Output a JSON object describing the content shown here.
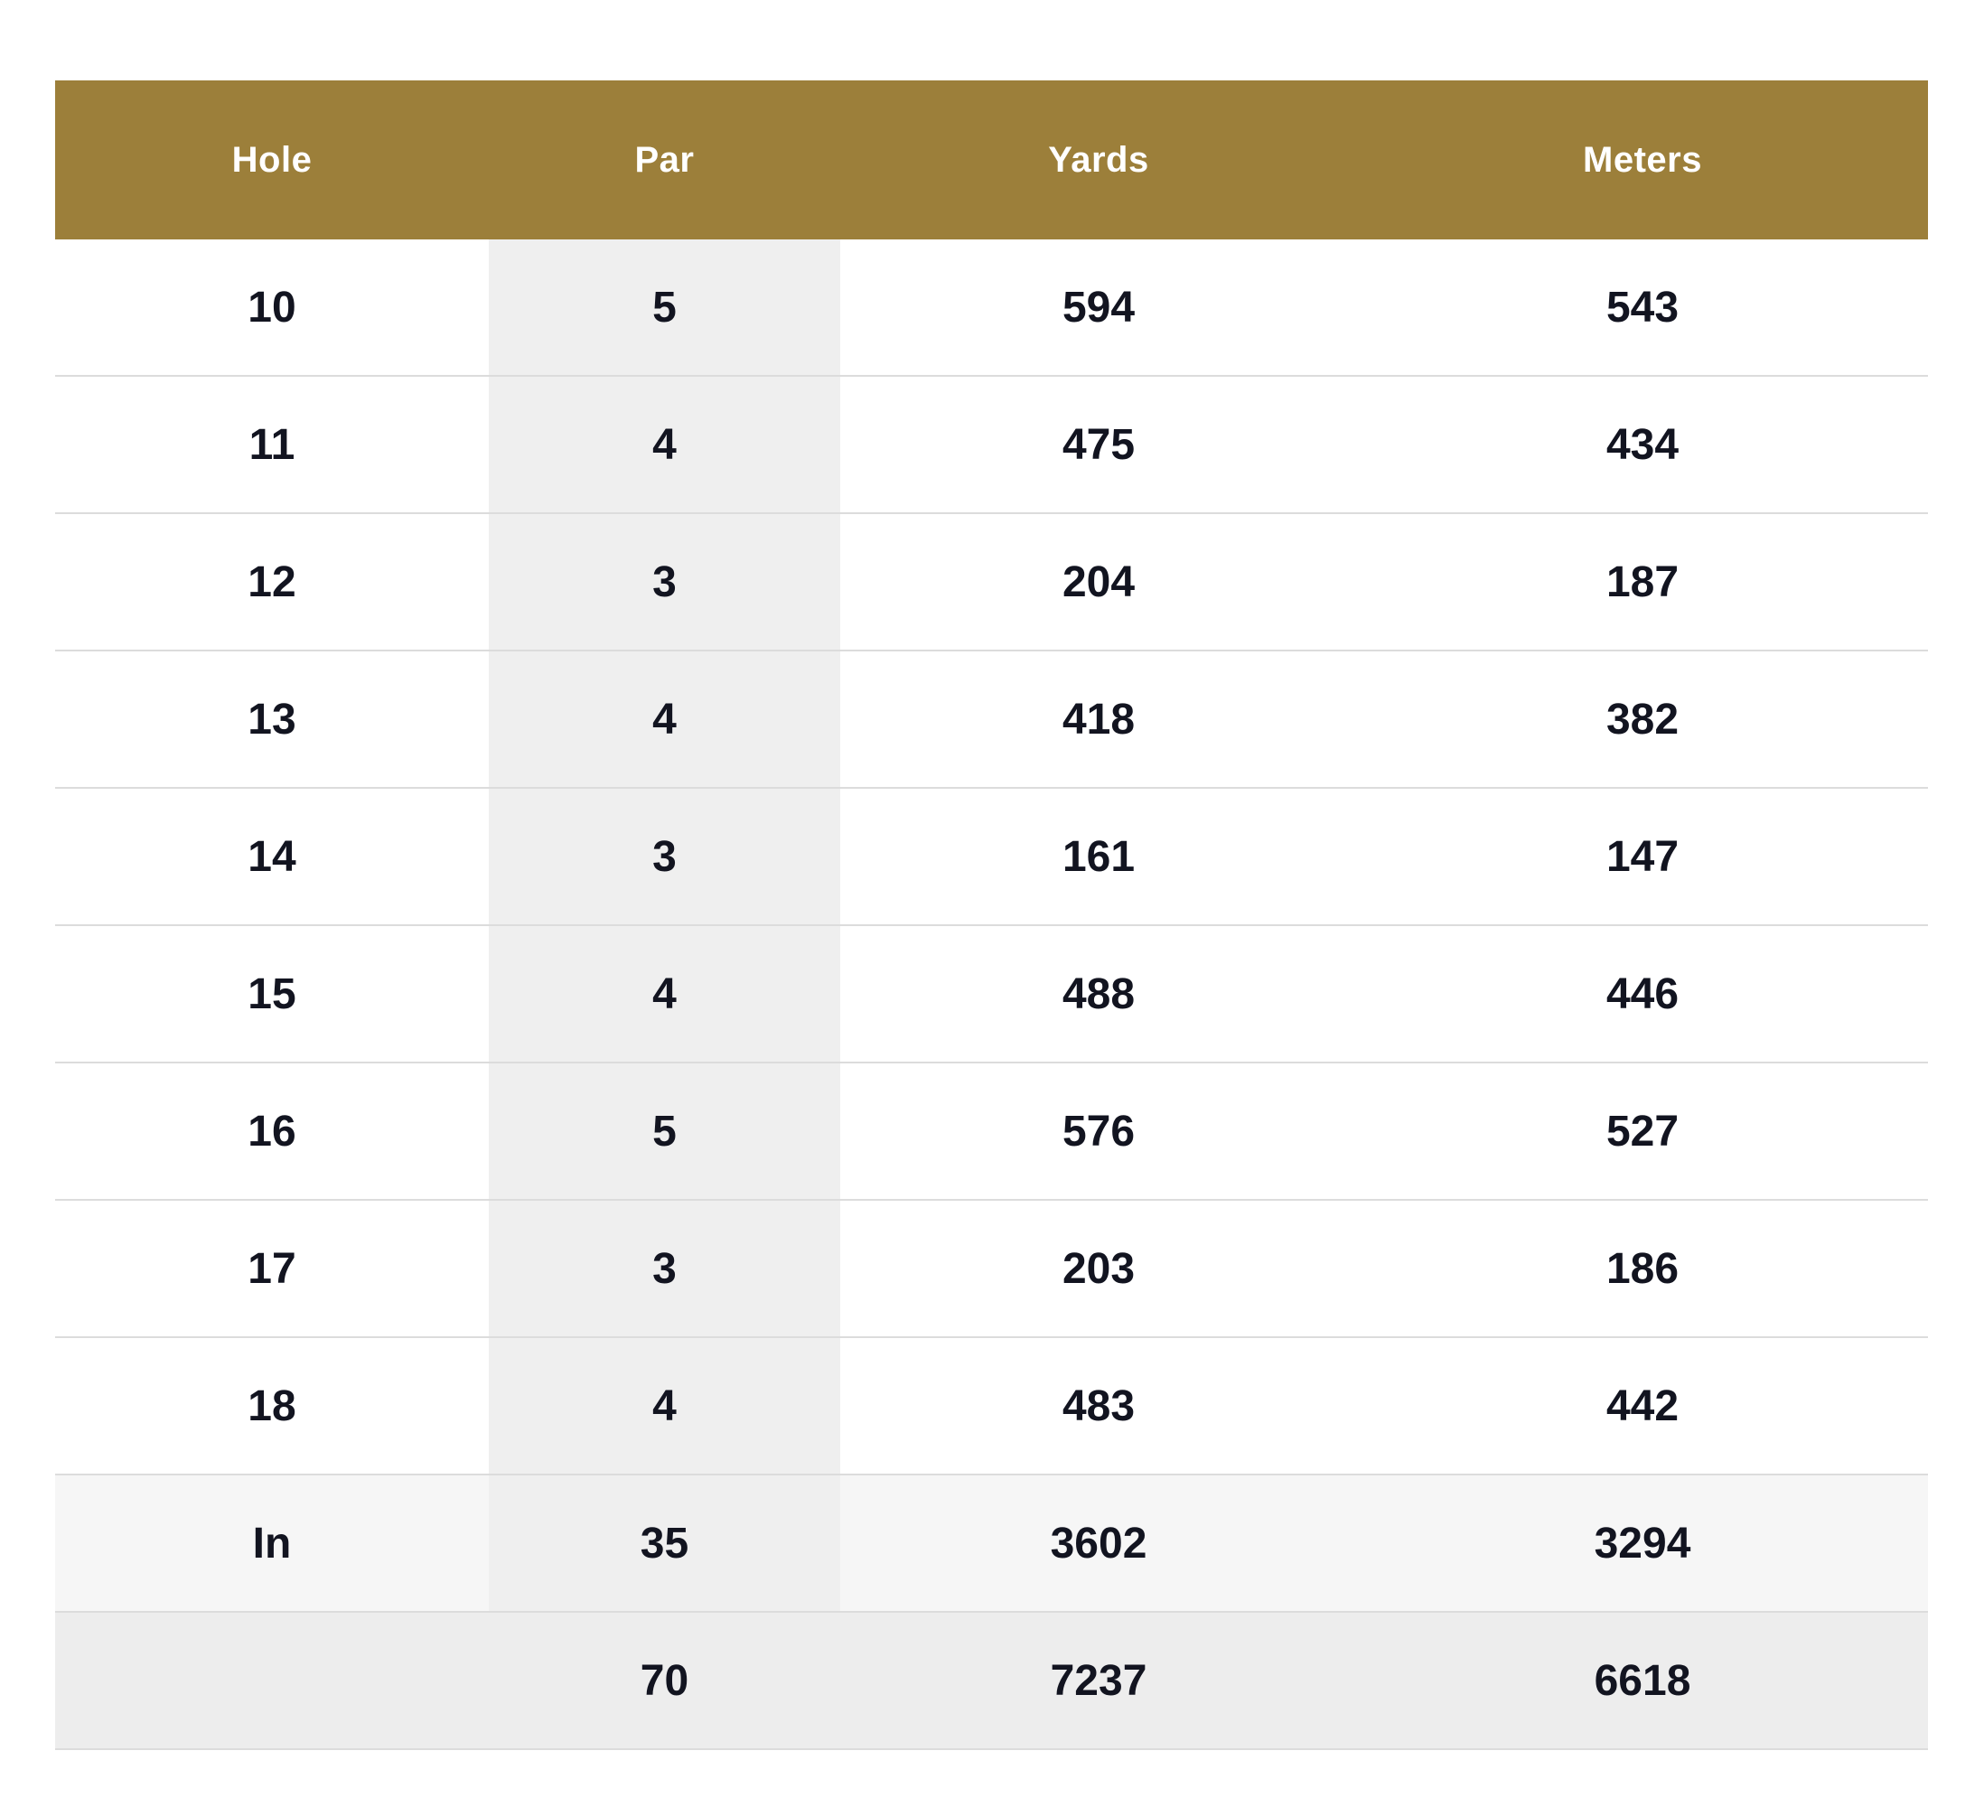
{
  "theme": {
    "header_bg": "#9c7f3a",
    "header_text": "#ffffff",
    "par_column_bg": "#efefef",
    "summary_row_bg": "#f6f6f6",
    "total_row_bg": "#ededed",
    "divider": "#dcdcdc",
    "cell_text": "#121420"
  },
  "table": {
    "headers": {
      "hole": "Hole",
      "par": "Par",
      "yards": "Yards",
      "meters": "Meters"
    },
    "rows": [
      {
        "hole": "10",
        "par": "5",
        "yards": "594",
        "meters": "543"
      },
      {
        "hole": "11",
        "par": "4",
        "yards": "475",
        "meters": "434"
      },
      {
        "hole": "12",
        "par": "3",
        "yards": "204",
        "meters": "187"
      },
      {
        "hole": "13",
        "par": "4",
        "yards": "418",
        "meters": "382"
      },
      {
        "hole": "14",
        "par": "3",
        "yards": "161",
        "meters": "147"
      },
      {
        "hole": "15",
        "par": "4",
        "yards": "488",
        "meters": "446"
      },
      {
        "hole": "16",
        "par": "5",
        "yards": "576",
        "meters": "527"
      },
      {
        "hole": "17",
        "par": "3",
        "yards": "203",
        "meters": "186"
      },
      {
        "hole": "18",
        "par": "4",
        "yards": "483",
        "meters": "442"
      }
    ],
    "in_total": {
      "hole": "In",
      "par": "35",
      "yards": "3602",
      "meters": "3294"
    },
    "grand_total": {
      "hole": "",
      "par": "70",
      "yards": "7237",
      "meters": "6618"
    }
  }
}
